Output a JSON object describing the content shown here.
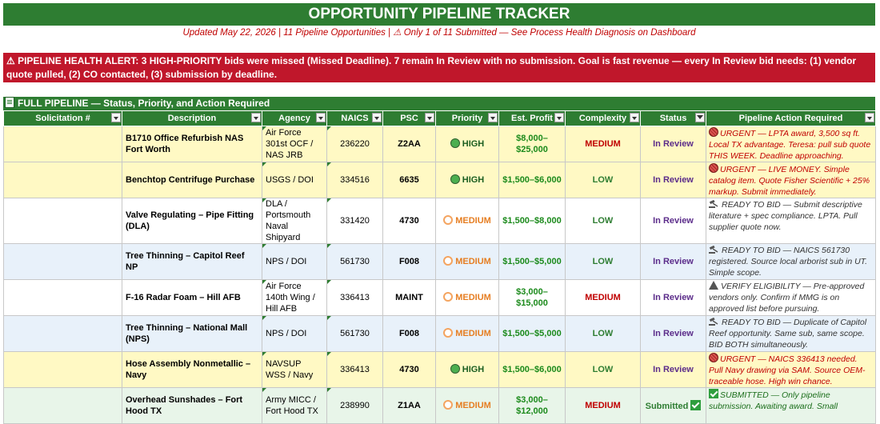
{
  "title": "OPPORTUNITY PIPELINE TRACKER",
  "subtitle": "Updated May 22, 2026  |  11 Pipeline Opportunities  |  ⚠ Only 1 of 11 Submitted — See Process Health Diagnosis on Dashboard",
  "alert": "⚠ PIPELINE HEALTH ALERT: 3 HIGH-PRIORITY bids were missed (Missed Deadline). 7 remain In Review with no submission. Goal is fast revenue — every In Review bid needs: (1) vendor quote pulled, (2) CO contacted, (3) submission by deadline.",
  "section_title": "FULL PIPELINE — Status, Priority, and Action Required",
  "colors": {
    "header_green": "#2e7d32",
    "alert_red": "#c0172b",
    "row_yellow": "#fff9c4",
    "row_blue": "#e8f1fa",
    "row_green": "#e8f5e9"
  },
  "columns": [
    "Solicitation #",
    "Description",
    "Agency",
    "NAICS",
    "PSC",
    "Priority",
    "Est. Profit",
    "Complexity",
    "Status",
    "Pipeline Action Required"
  ],
  "rows": [
    {
      "solicitation": "",
      "description": "B1710 Office Refurbish NAS Fort Worth",
      "agency": "Air Force 301st OCF / NAS JRB",
      "naics": "236220",
      "psc": "Z2AA",
      "priority": "HIGH",
      "profit": "$8,000–$25,000",
      "complexity": "MEDIUM",
      "status": "In Review",
      "action_icon": "red-circle-icon",
      "action": "URGENT — LPTA award, 3,500 sq ft. Local TX advantage. Teresa: pull sub quote THIS WEEK. Deadline approaching."
    },
    {
      "solicitation": "",
      "description": "Benchtop Centrifuge Purchase",
      "agency": "USGS / DOI",
      "naics": "334516",
      "psc": "6635",
      "priority": "HIGH",
      "profit": "$1,500–$6,000",
      "complexity": "LOW",
      "status": "In Review",
      "action_icon": "red-circle-icon",
      "action": "URGENT — LIVE MONEY. Simple catalog item. Quote Fisher Scientific + 25% markup. Submit immediately."
    },
    {
      "solicitation": "",
      "description": "Valve Regulating – Pipe Fitting (DLA)",
      "agency": "DLA / Portsmouth Naval Shipyard",
      "naics": "331420",
      "psc": "4730",
      "priority": "MEDIUM",
      "profit": "$1,500–$8,000",
      "complexity": "LOW",
      "status": "In Review",
      "action_icon": "gavel-icon",
      "action": "READY TO BID — Submit descriptive literature + spec compliance. LPTA. Pull supplier quote now."
    },
    {
      "solicitation": "",
      "description": "Tree Thinning – Capitol Reef NP",
      "agency": "NPS / DOI",
      "naics": "561730",
      "psc": "F008",
      "priority": "MEDIUM",
      "profit": "$1,500–$5,000",
      "complexity": "LOW",
      "status": "In Review",
      "action_icon": "gavel-icon",
      "action": "READY TO BID — NAICS 561730 registered. Source local arborist sub in UT. Simple scope."
    },
    {
      "solicitation": "",
      "description": "F-16 Radar Foam – Hill AFB",
      "agency": "Air Force 140th Wing / Hill AFB",
      "naics": "336413",
      "psc": "MAINT",
      "priority": "MEDIUM",
      "profit": "$3,000–$15,000",
      "complexity": "MEDIUM",
      "status": "In Review",
      "action_icon": "warning-icon",
      "action": "VERIFY ELIGIBILITY — Pre-approved vendors only. Confirm if MMG is on approved list before pursuing."
    },
    {
      "solicitation": "",
      "description": "Tree Thinning – National Mall (NPS)",
      "agency": "NPS / DOI",
      "naics": "561730",
      "psc": "F008",
      "priority": "MEDIUM",
      "profit": "$1,500–$5,000",
      "complexity": "LOW",
      "status": "In Review",
      "action_icon": "gavel-icon",
      "action": "READY TO BID — Duplicate of Capitol Reef opportunity. Same sub, same scope. BID BOTH simultaneously."
    },
    {
      "solicitation": "",
      "description": "Hose Assembly Nonmetallic – Navy",
      "agency": "NAVSUP WSS / Navy",
      "naics": "336413",
      "psc": "4730",
      "priority": "HIGH",
      "profit": "$1,500–$6,000",
      "complexity": "LOW",
      "status": "In Review",
      "action_icon": "red-circle-icon",
      "action": "URGENT — NAICS 336413 needed. Pull Navy drawing via SAM. Source OEM-traceable hose. High win chance."
    },
    {
      "solicitation": "",
      "description": "Overhead Sunshades – Fort Hood TX",
      "agency": "Army MICC / Fort Hood TX",
      "naics": "238990",
      "psc": "Z1AA",
      "priority": "MEDIUM",
      "profit": "$3,000–$12,000",
      "complexity": "MEDIUM",
      "status": "Submitted",
      "action_icon": "check-icon",
      "action": "SUBMITTED — Only pipeline submission. Awaiting award. Small"
    }
  ]
}
